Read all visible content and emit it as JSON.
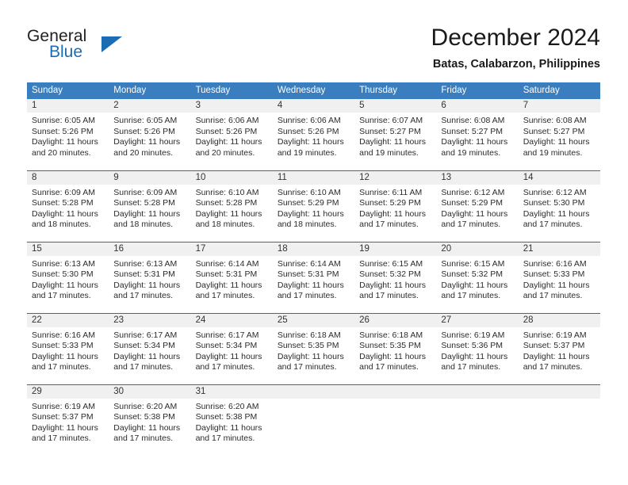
{
  "brand": {
    "name_part1": "General",
    "name_part2": "Blue",
    "logo_icon": "blue-triangle-icon",
    "accent_color": "#1b6cb3"
  },
  "header": {
    "title": "December 2024",
    "subtitle": "Batas, Calabarzon, Philippines"
  },
  "theme": {
    "header_bg": "#3a7ebf",
    "header_text": "#ffffff",
    "daynum_band_bg": "#f0f0f0",
    "row_divider": "#2c6ca8"
  },
  "calendar": {
    "weekday_headers": [
      "Sunday",
      "Monday",
      "Tuesday",
      "Wednesday",
      "Thursday",
      "Friday",
      "Saturday"
    ],
    "weeks": [
      [
        {
          "day": "1",
          "sunrise": "Sunrise: 6:05 AM",
          "sunset": "Sunset: 5:26 PM",
          "daylight_line1": "Daylight: 11 hours",
          "daylight_line2": "and 20 minutes."
        },
        {
          "day": "2",
          "sunrise": "Sunrise: 6:05 AM",
          "sunset": "Sunset: 5:26 PM",
          "daylight_line1": "Daylight: 11 hours",
          "daylight_line2": "and 20 minutes."
        },
        {
          "day": "3",
          "sunrise": "Sunrise: 6:06 AM",
          "sunset": "Sunset: 5:26 PM",
          "daylight_line1": "Daylight: 11 hours",
          "daylight_line2": "and 20 minutes."
        },
        {
          "day": "4",
          "sunrise": "Sunrise: 6:06 AM",
          "sunset": "Sunset: 5:26 PM",
          "daylight_line1": "Daylight: 11 hours",
          "daylight_line2": "and 19 minutes."
        },
        {
          "day": "5",
          "sunrise": "Sunrise: 6:07 AM",
          "sunset": "Sunset: 5:27 PM",
          "daylight_line1": "Daylight: 11 hours",
          "daylight_line2": "and 19 minutes."
        },
        {
          "day": "6",
          "sunrise": "Sunrise: 6:08 AM",
          "sunset": "Sunset: 5:27 PM",
          "daylight_line1": "Daylight: 11 hours",
          "daylight_line2": "and 19 minutes."
        },
        {
          "day": "7",
          "sunrise": "Sunrise: 6:08 AM",
          "sunset": "Sunset: 5:27 PM",
          "daylight_line1": "Daylight: 11 hours",
          "daylight_line2": "and 19 minutes."
        }
      ],
      [
        {
          "day": "8",
          "sunrise": "Sunrise: 6:09 AM",
          "sunset": "Sunset: 5:28 PM",
          "daylight_line1": "Daylight: 11 hours",
          "daylight_line2": "and 18 minutes."
        },
        {
          "day": "9",
          "sunrise": "Sunrise: 6:09 AM",
          "sunset": "Sunset: 5:28 PM",
          "daylight_line1": "Daylight: 11 hours",
          "daylight_line2": "and 18 minutes."
        },
        {
          "day": "10",
          "sunrise": "Sunrise: 6:10 AM",
          "sunset": "Sunset: 5:28 PM",
          "daylight_line1": "Daylight: 11 hours",
          "daylight_line2": "and 18 minutes."
        },
        {
          "day": "11",
          "sunrise": "Sunrise: 6:10 AM",
          "sunset": "Sunset: 5:29 PM",
          "daylight_line1": "Daylight: 11 hours",
          "daylight_line2": "and 18 minutes."
        },
        {
          "day": "12",
          "sunrise": "Sunrise: 6:11 AM",
          "sunset": "Sunset: 5:29 PM",
          "daylight_line1": "Daylight: 11 hours",
          "daylight_line2": "and 17 minutes."
        },
        {
          "day": "13",
          "sunrise": "Sunrise: 6:12 AM",
          "sunset": "Sunset: 5:29 PM",
          "daylight_line1": "Daylight: 11 hours",
          "daylight_line2": "and 17 minutes."
        },
        {
          "day": "14",
          "sunrise": "Sunrise: 6:12 AM",
          "sunset": "Sunset: 5:30 PM",
          "daylight_line1": "Daylight: 11 hours",
          "daylight_line2": "and 17 minutes."
        }
      ],
      [
        {
          "day": "15",
          "sunrise": "Sunrise: 6:13 AM",
          "sunset": "Sunset: 5:30 PM",
          "daylight_line1": "Daylight: 11 hours",
          "daylight_line2": "and 17 minutes."
        },
        {
          "day": "16",
          "sunrise": "Sunrise: 6:13 AM",
          "sunset": "Sunset: 5:31 PM",
          "daylight_line1": "Daylight: 11 hours",
          "daylight_line2": "and 17 minutes."
        },
        {
          "day": "17",
          "sunrise": "Sunrise: 6:14 AM",
          "sunset": "Sunset: 5:31 PM",
          "daylight_line1": "Daylight: 11 hours",
          "daylight_line2": "and 17 minutes."
        },
        {
          "day": "18",
          "sunrise": "Sunrise: 6:14 AM",
          "sunset": "Sunset: 5:31 PM",
          "daylight_line1": "Daylight: 11 hours",
          "daylight_line2": "and 17 minutes."
        },
        {
          "day": "19",
          "sunrise": "Sunrise: 6:15 AM",
          "sunset": "Sunset: 5:32 PM",
          "daylight_line1": "Daylight: 11 hours",
          "daylight_line2": "and 17 minutes."
        },
        {
          "day": "20",
          "sunrise": "Sunrise: 6:15 AM",
          "sunset": "Sunset: 5:32 PM",
          "daylight_line1": "Daylight: 11 hours",
          "daylight_line2": "and 17 minutes."
        },
        {
          "day": "21",
          "sunrise": "Sunrise: 6:16 AM",
          "sunset": "Sunset: 5:33 PM",
          "daylight_line1": "Daylight: 11 hours",
          "daylight_line2": "and 17 minutes."
        }
      ],
      [
        {
          "day": "22",
          "sunrise": "Sunrise: 6:16 AM",
          "sunset": "Sunset: 5:33 PM",
          "daylight_line1": "Daylight: 11 hours",
          "daylight_line2": "and 17 minutes."
        },
        {
          "day": "23",
          "sunrise": "Sunrise: 6:17 AM",
          "sunset": "Sunset: 5:34 PM",
          "daylight_line1": "Daylight: 11 hours",
          "daylight_line2": "and 17 minutes."
        },
        {
          "day": "24",
          "sunrise": "Sunrise: 6:17 AM",
          "sunset": "Sunset: 5:34 PM",
          "daylight_line1": "Daylight: 11 hours",
          "daylight_line2": "and 17 minutes."
        },
        {
          "day": "25",
          "sunrise": "Sunrise: 6:18 AM",
          "sunset": "Sunset: 5:35 PM",
          "daylight_line1": "Daylight: 11 hours",
          "daylight_line2": "and 17 minutes."
        },
        {
          "day": "26",
          "sunrise": "Sunrise: 6:18 AM",
          "sunset": "Sunset: 5:35 PM",
          "daylight_line1": "Daylight: 11 hours",
          "daylight_line2": "and 17 minutes."
        },
        {
          "day": "27",
          "sunrise": "Sunrise: 6:19 AM",
          "sunset": "Sunset: 5:36 PM",
          "daylight_line1": "Daylight: 11 hours",
          "daylight_line2": "and 17 minutes."
        },
        {
          "day": "28",
          "sunrise": "Sunrise: 6:19 AM",
          "sunset": "Sunset: 5:37 PM",
          "daylight_line1": "Daylight: 11 hours",
          "daylight_line2": "and 17 minutes."
        }
      ],
      [
        {
          "day": "29",
          "sunrise": "Sunrise: 6:19 AM",
          "sunset": "Sunset: 5:37 PM",
          "daylight_line1": "Daylight: 11 hours",
          "daylight_line2": "and 17 minutes."
        },
        {
          "day": "30",
          "sunrise": "Sunrise: 6:20 AM",
          "sunset": "Sunset: 5:38 PM",
          "daylight_line1": "Daylight: 11 hours",
          "daylight_line2": "and 17 minutes."
        },
        {
          "day": "31",
          "sunrise": "Sunrise: 6:20 AM",
          "sunset": "Sunset: 5:38 PM",
          "daylight_line1": "Daylight: 11 hours",
          "daylight_line2": "and 17 minutes."
        },
        {
          "day": "",
          "sunrise": "",
          "sunset": "",
          "daylight_line1": "",
          "daylight_line2": ""
        },
        {
          "day": "",
          "sunrise": "",
          "sunset": "",
          "daylight_line1": "",
          "daylight_line2": ""
        },
        {
          "day": "",
          "sunrise": "",
          "sunset": "",
          "daylight_line1": "",
          "daylight_line2": ""
        },
        {
          "day": "",
          "sunrise": "",
          "sunset": "",
          "daylight_line1": "",
          "daylight_line2": ""
        }
      ]
    ]
  }
}
